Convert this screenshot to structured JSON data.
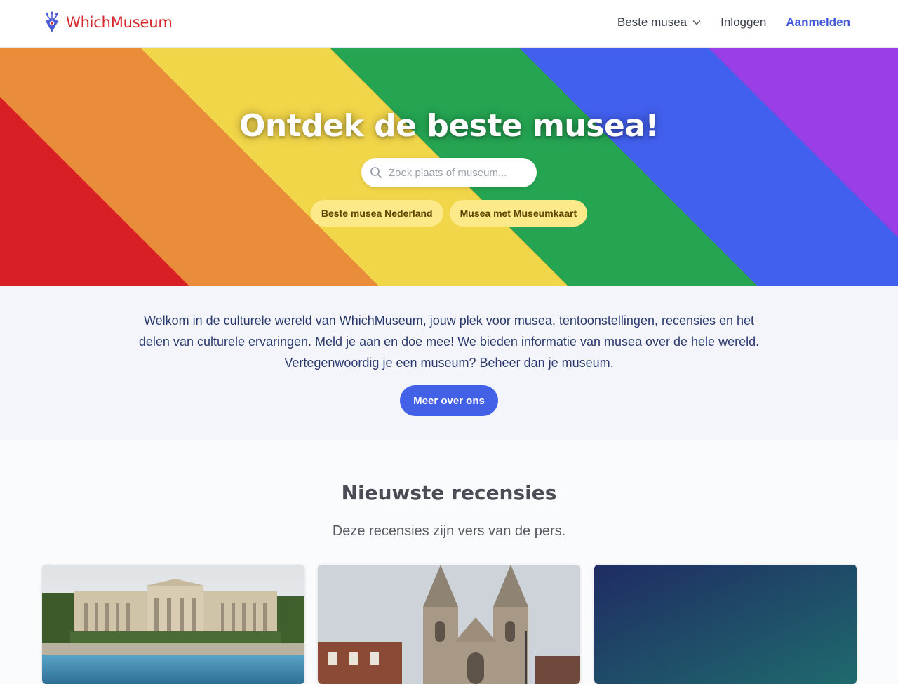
{
  "header": {
    "brand": "WhichMuseum",
    "nav": [
      {
        "label": "Beste musea"
      },
      {
        "label": "Inloggen"
      },
      {
        "label": "Aanmelden"
      }
    ]
  },
  "hero": {
    "title": "Ontdek de beste musea!",
    "search_placeholder": "Zoek plaats of museum...",
    "pills": [
      "Beste musea Nederland",
      "Musea met Museumkaart"
    ],
    "stripe_colors": [
      "#d91f26",
      "#e98d3b",
      "#f2d649",
      "#25a552",
      "#4260ee",
      "#9a3ee8"
    ]
  },
  "intro": {
    "text_1": "Welkom in de culturele wereld van WhichMuseum, jouw plek voor musea, tentoonstellingen, recensies en het delen van culturele ervaringen. ",
    "link_1": "Meld je aan",
    "text_2": " en doe mee! We bieden informatie van musea over de hele wereld. Vertegenwoordig je een museum? ",
    "link_2": "Beheer dan je museum",
    "text_3": ".",
    "cta": "Meer over ons"
  },
  "reviews": {
    "title": "Nieuwste recensies",
    "subtitle": "Deze recensies zijn vers van de pers."
  },
  "colors": {
    "brand_red": "#d4262c",
    "accent_blue": "#4361e6",
    "pill_yellow": "#fbe98a"
  }
}
